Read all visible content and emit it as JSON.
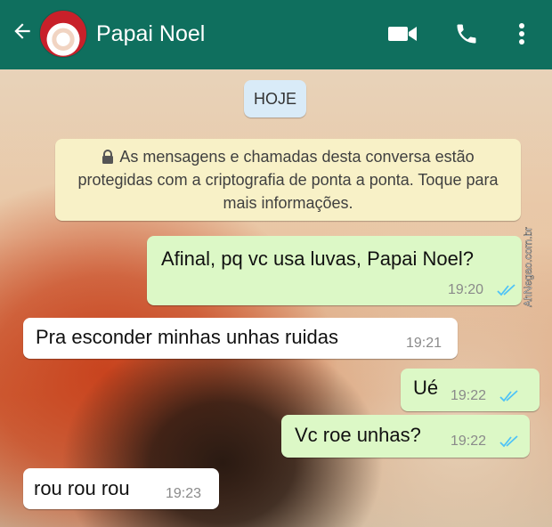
{
  "header": {
    "back_icon": "arrow-left-icon",
    "contact_name": "Papai Noel",
    "icons": [
      "video-icon",
      "phone-icon",
      "more-vertical-icon"
    ],
    "color": "#0f6f5e"
  },
  "date_badge": "HOJE",
  "encryption_notice": "As mensagens e chamadas desta conversa estão protegidas com a criptografia de ponta a ponta. Toque para mais informações.",
  "messages": [
    {
      "direction": "out",
      "text": "Afinal, pq vc usa luvas, Papai Noel?",
      "time": "19:20",
      "status": "read"
    },
    {
      "direction": "in",
      "text": "Pra esconder minhas unhas ruidas",
      "time": "19:21"
    },
    {
      "direction": "out",
      "text": "Ué",
      "time": "19:22",
      "status": "read"
    },
    {
      "direction": "out",
      "text": "Vc roe unhas?",
      "time": "19:22",
      "status": "read"
    },
    {
      "direction": "in",
      "text": "rou rou rou",
      "time": "19:23"
    }
  ],
  "watermark": "AhNegao.com.br",
  "colors": {
    "outgoing": "#dcf8c6",
    "incoming": "#ffffff",
    "read_ticks": "#4fc3f7"
  }
}
